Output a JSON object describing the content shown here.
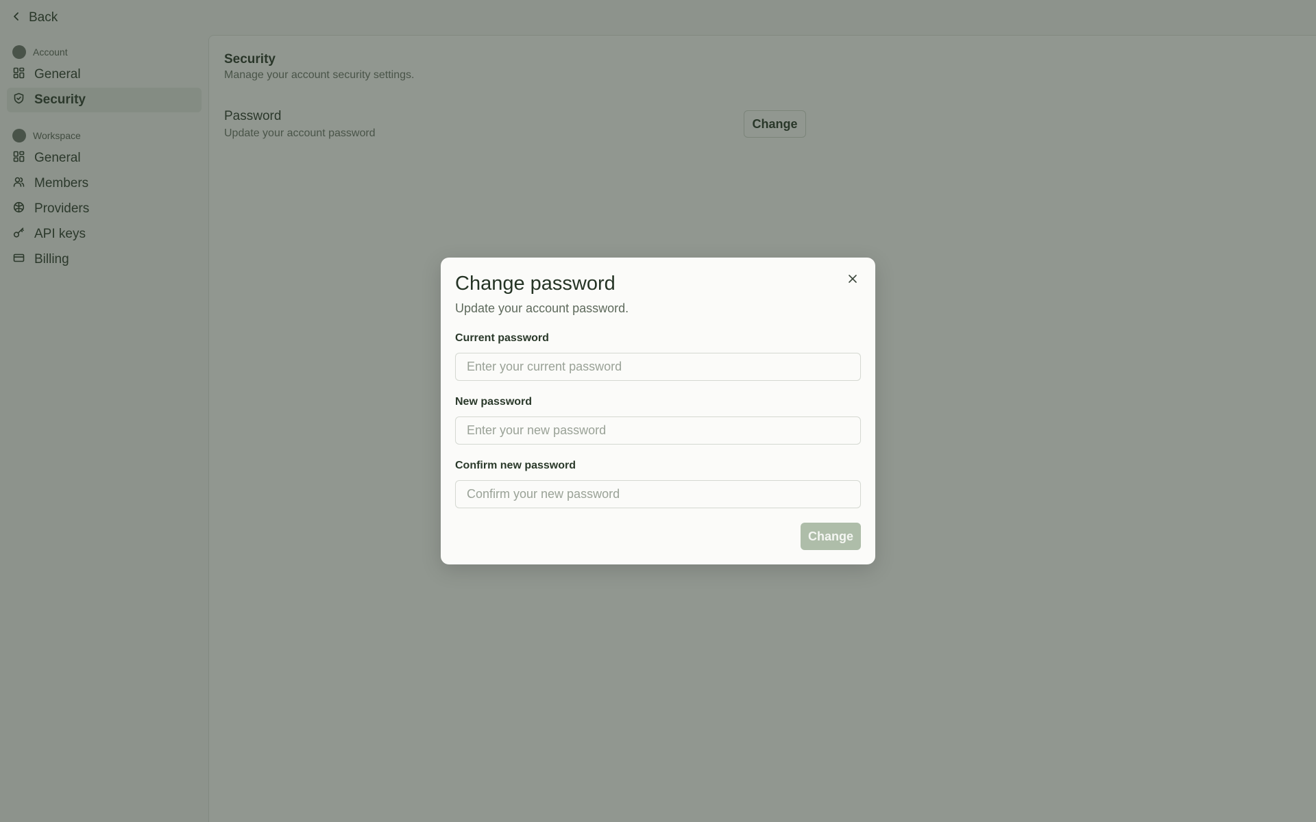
{
  "topbar": {
    "back_label": "Back"
  },
  "sidebar": {
    "account_group": "Account",
    "account_items": [
      {
        "label": "General",
        "icon": "grid-icon"
      },
      {
        "label": "Security",
        "icon": "shield-icon",
        "active": true
      }
    ],
    "workspace_group": "Workspace",
    "workspace_items": [
      {
        "label": "General",
        "icon": "grid-icon"
      },
      {
        "label": "Members",
        "icon": "users-icon"
      },
      {
        "label": "Providers",
        "icon": "brain-icon"
      },
      {
        "label": "API keys",
        "icon": "key-icon"
      },
      {
        "label": "Billing",
        "icon": "credit-card-icon"
      }
    ]
  },
  "main": {
    "section_title": "Security",
    "section_desc": "Manage your account security settings.",
    "password_row": {
      "title": "Password",
      "desc": "Update your account password",
      "button": "Change"
    }
  },
  "modal": {
    "title": "Change password",
    "subtitle": "Update your account password.",
    "current": {
      "label": "Current password",
      "placeholder": "Enter your current password",
      "value": ""
    },
    "new": {
      "label": "New password",
      "placeholder": "Enter your new password",
      "value": ""
    },
    "confirm": {
      "label": "Confirm new password",
      "placeholder": "Confirm your new password",
      "value": ""
    },
    "submit": "Change"
  },
  "colors": {
    "accent_disabled": "#aebda9",
    "active_nav": "#e1e4de",
    "overlay": "rgba(40,52,40,0.5)"
  }
}
